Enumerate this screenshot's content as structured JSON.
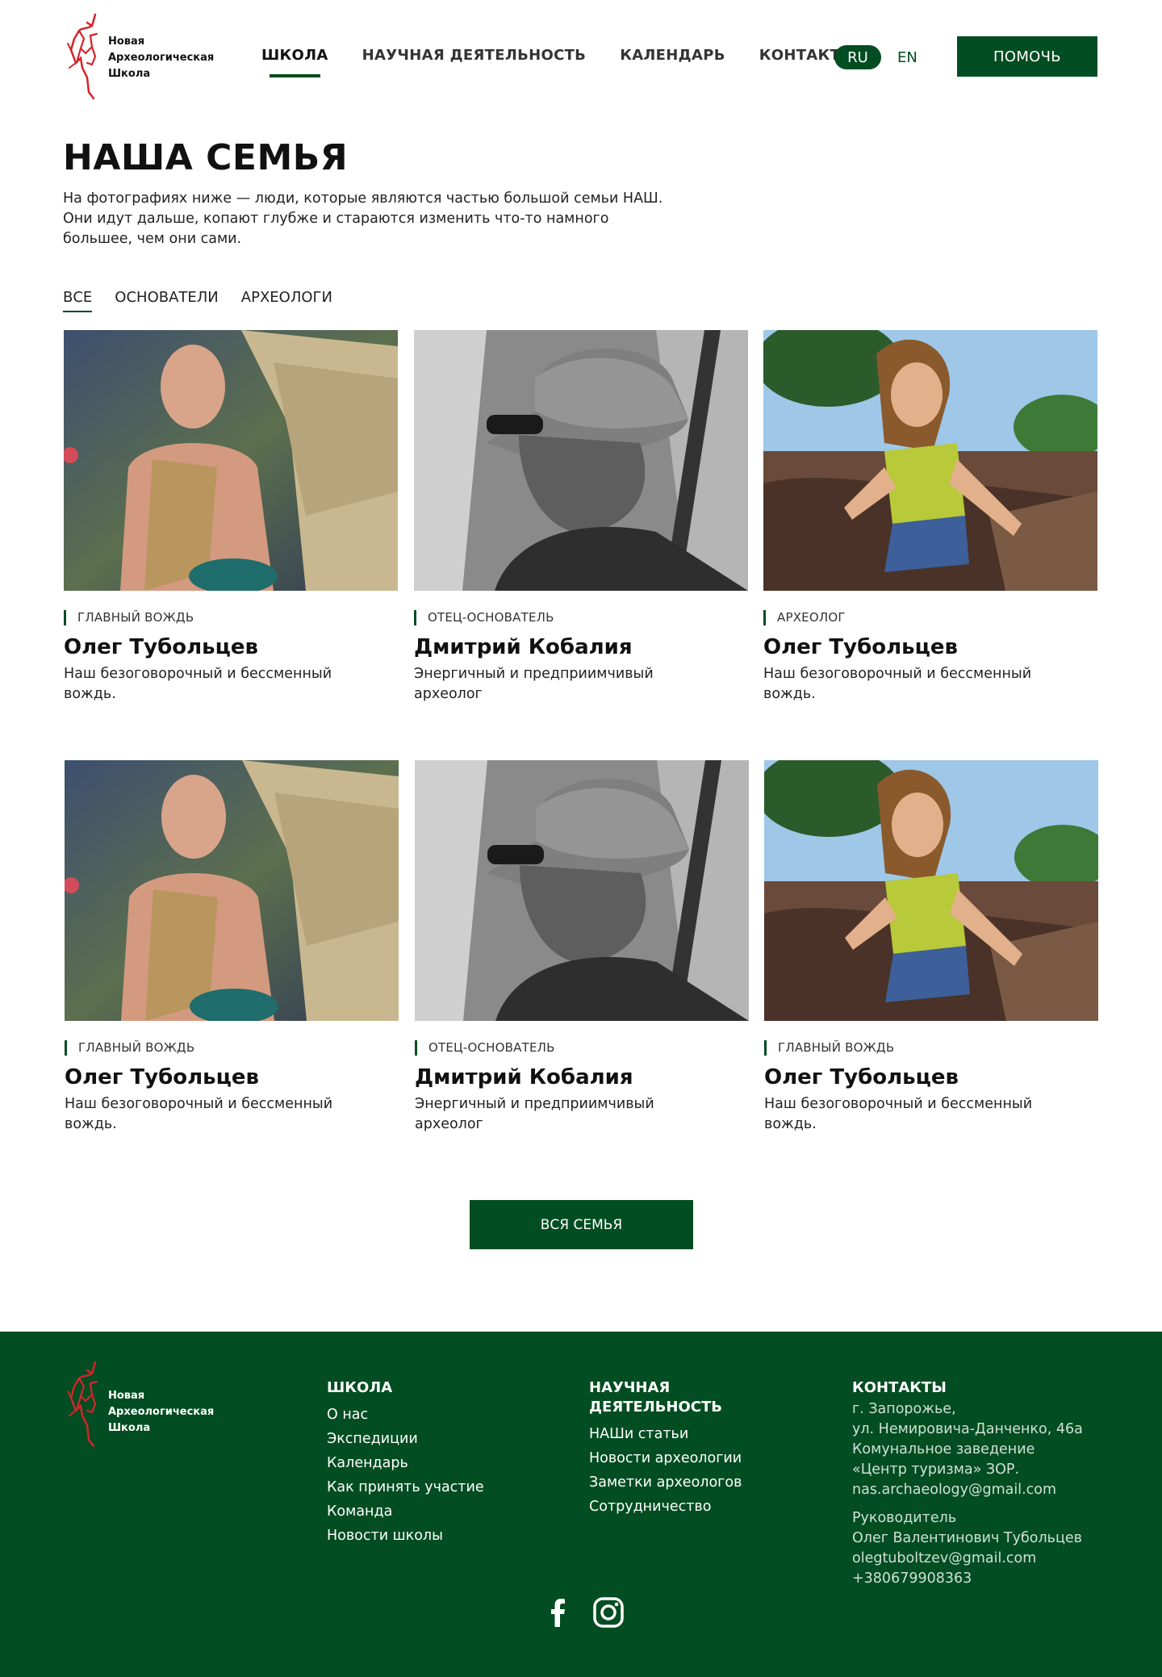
{
  "logo": {
    "line1": "Новая",
    "line2": "Археологическая",
    "line3": "Школа"
  },
  "nav": {
    "items": [
      {
        "label": "ШКОЛА",
        "active": true
      },
      {
        "label": "НАУЧНАЯ ДЕЯТЕЛЬНОСТЬ",
        "active": false
      },
      {
        "label": "КАЛЕНДАРЬ",
        "active": false
      },
      {
        "label": "КОНТАКТЫ",
        "active": false
      }
    ]
  },
  "lang": {
    "ru": "RU",
    "en": "EN",
    "active": "RU"
  },
  "help_button": "ПОМОЧЬ",
  "page": {
    "title": "НАША СЕМЬЯ",
    "intro": "На фотографиях ниже — люди, которые являются частью большой семьи НАШ. Они идут дальше, копают глубже и стараются изменить что-то намного большее, чем они сами."
  },
  "filters": [
    {
      "label": "ВСЕ",
      "active": true
    },
    {
      "label": "ОСНОВАТЕЛИ",
      "active": false
    },
    {
      "label": "АРХЕОЛОГИ",
      "active": false
    }
  ],
  "cards": [
    {
      "photo": "man-outdoor-photo",
      "role": "ГЛАВНЫЙ ВОЖДЬ",
      "name": "Олег Тубольцев",
      "desc": "Наш безоговорочный и бессменный вождь."
    },
    {
      "photo": "man-hat-bw-photo",
      "role": "ОТЕЦ-ОСНОВАТЕЛЬ",
      "name": "Дмитрий Кобалия",
      "desc": "Энергичный и предприимчивый археолог"
    },
    {
      "photo": "girl-excavation-photo",
      "role": "АРХЕОЛОГ",
      "name": "Олег Тубольцев",
      "desc": "Наш безоговорочный и бессменный вождь."
    },
    {
      "photo": "man-outdoor-photo",
      "role": "ГЛАВНЫЙ ВОЖДЬ",
      "name": "Олег Тубольцев",
      "desc": "Наш безоговорочный и бессменный вождь."
    },
    {
      "photo": "man-hat-bw-photo",
      "role": "ОТЕЦ-ОСНОВАТЕЛЬ",
      "name": "Дмитрий Кобалия",
      "desc": "Энергичный и предприимчивый археолог"
    },
    {
      "photo": "girl-excavation-photo",
      "role": "ГЛАВНЫЙ ВОЖДЬ",
      "name": "Олег Тубольцев",
      "desc": "Наш безоговорочный и бессменный вождь."
    }
  ],
  "more_button": "ВСЯ СЕМЬЯ",
  "footer": {
    "school": {
      "title": "ШКОЛА",
      "links": [
        "О нас",
        "Экспедиции",
        "Календарь",
        "Как принять участие",
        "Команда",
        "Новости школы"
      ]
    },
    "science": {
      "title_line1": "НАУЧНАЯ",
      "title_line2": "ДЕЯТЕЛЬНОСТЬ",
      "links": [
        "НАШи статьи",
        "Новости археологии",
        "Заметки археологов",
        "Сотрудничество"
      ]
    },
    "contacts": {
      "title": "КОНТАКТЫ",
      "lines1": [
        "г. Запорожье,",
        "ул. Немировича-Данченко, 46а",
        "Комунальное заведение",
        "«Центр туризма» ЗОР.",
        "nas.archaeology@gmail.com"
      ],
      "lines2": [
        "Руководитель",
        "Олег Валентинович Тубольцев",
        "olegtuboltzev@gmail.com",
        "+380679908363"
      ]
    },
    "social": [
      "facebook-icon",
      "instagram-icon"
    ]
  },
  "colors": {
    "brand_green": "#024d21",
    "logo_red": "#d4242a"
  }
}
